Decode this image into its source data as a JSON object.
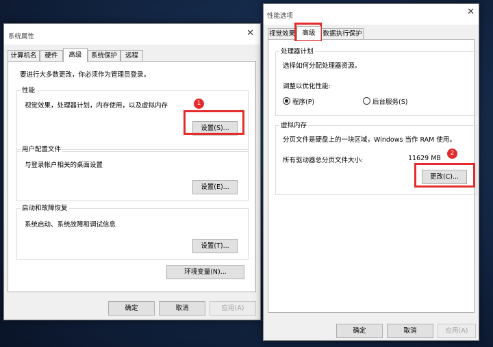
{
  "left_window": {
    "title": "系统属性",
    "tabs": [
      "计算机名",
      "硬件",
      "高级",
      "系统保护",
      "远程"
    ],
    "admin_note": "要进行大多数更改，你必须作为管理员登录。",
    "performance": {
      "label": "性能",
      "desc": "视觉效果，处理器计划，内存使用，以及虚拟内存",
      "button": "设置(S)..."
    },
    "user_profiles": {
      "label": "用户配置文件",
      "desc": "与登录帐户相关的桌面设置",
      "button": "设置(E)..."
    },
    "startup": {
      "label": "启动和故障恢复",
      "desc": "系统启动、系统故障和调试信息",
      "button": "设置(T)..."
    },
    "env_button": "环境变量(N)...",
    "ok": "确定",
    "cancel": "取消",
    "apply": "应用(A)"
  },
  "right_window": {
    "title": "性能选项",
    "tabs": [
      "视觉效果",
      "高级",
      "数据执行保护"
    ],
    "processor": {
      "label": "处理器计划",
      "desc": "选择如何分配处理器资源。",
      "adjust_label": "调整以优化性能:",
      "option_programs": "程序(P)",
      "option_services": "后台服务(S)",
      "selected": "programs"
    },
    "virtual_memory": {
      "label": "虚拟内存",
      "desc": "分页文件是硬盘上的一块区域，Windows 当作 RAM 使用。",
      "total_label": "所有驱动器总分页文件大小:",
      "total_value": "11629 MB",
      "change_button": "更改(C)..."
    },
    "ok": "确定",
    "cancel": "取消",
    "apply": "应用(A)"
  },
  "annotations": {
    "badge1": "1",
    "badge2": "2",
    "color": "#e52b2b"
  }
}
